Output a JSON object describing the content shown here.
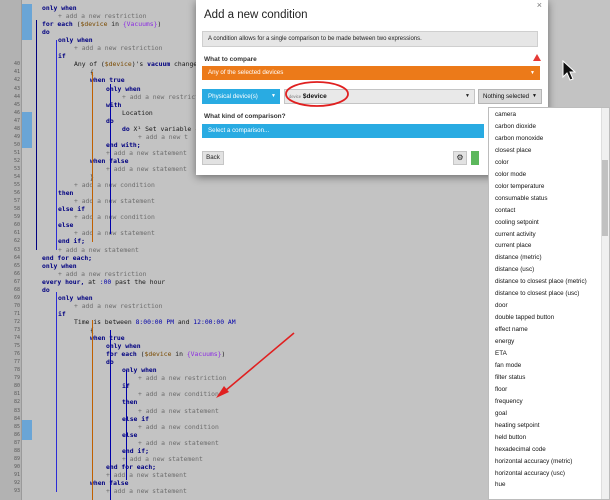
{
  "editor": {
    "lines": [
      {
        "n": "",
        "indent": 0,
        "parts": [
          {
            "c": "kw",
            "t": "only when"
          }
        ]
      },
      {
        "n": "",
        "indent": 1,
        "parts": [
          {
            "c": "add",
            "t": "+ add a new restriction"
          }
        ]
      },
      {
        "n": "",
        "indent": 0,
        "parts": [
          {
            "c": "kw",
            "t": "for each "
          },
          {
            "c": "",
            "t": "("
          },
          {
            "c": "var",
            "t": "$device"
          },
          {
            "c": "",
            "t": " in "
          },
          {
            "c": "var2",
            "t": "{Vacuums}"
          },
          {
            "c": "",
            "t": ")"
          }
        ]
      },
      {
        "n": "",
        "indent": 0,
        "parts": [
          {
            "c": "kw",
            "t": "do"
          }
        ]
      },
      {
        "n": "",
        "indent": 1,
        "parts": [
          {
            "c": "kw",
            "t": "only when"
          }
        ]
      },
      {
        "n": "",
        "indent": 2,
        "parts": [
          {
            "c": "add",
            "t": "+ add a new restriction"
          }
        ]
      },
      {
        "n": "",
        "indent": 1,
        "parts": [
          {
            "c": "kw",
            "t": "if"
          }
        ]
      },
      {
        "n": "",
        "indent": 2,
        "parts": [
          {
            "c": "",
            "t": "Any of ("
          },
          {
            "c": "var",
            "t": "$device"
          },
          {
            "c": "",
            "t": ")'s "
          },
          {
            "c": "kw",
            "t": "vacuum"
          },
          {
            "c": "",
            "t": " changes to 'c"
          }
        ]
      },
      {
        "n": "",
        "indent": 3,
        "parts": [
          {
            "c": "",
            "t": "{"
          }
        ]
      },
      {
        "n": "",
        "indent": 3,
        "parts": [
          {
            "c": "kw",
            "t": "when true"
          }
        ]
      },
      {
        "n": "",
        "indent": 4,
        "parts": [
          {
            "c": "kw",
            "t": "only when"
          }
        ]
      },
      {
        "n": "",
        "indent": 5,
        "parts": [
          {
            "c": "add",
            "t": "+ add a new restrict"
          }
        ]
      },
      {
        "n": "",
        "indent": 4,
        "parts": [
          {
            "c": "kw",
            "t": "with"
          }
        ]
      },
      {
        "n": "",
        "indent": 5,
        "parts": [
          {
            "c": "",
            "t": "Location"
          }
        ]
      },
      {
        "n": "",
        "indent": 4,
        "parts": [
          {
            "c": "kw",
            "t": "do"
          }
        ]
      },
      {
        "n": "",
        "indent": 5,
        "parts": [
          {
            "c": "kw",
            "t": "do "
          },
          {
            "c": "",
            "t": "X¹ Set variable "
          },
          {
            "c": "var",
            "t": "{$i"
          }
        ]
      },
      {
        "n": "",
        "indent": 6,
        "parts": [
          {
            "c": "add",
            "t": "+ add a new t"
          }
        ]
      },
      {
        "n": "",
        "indent": 4,
        "parts": [
          {
            "c": "kw",
            "t": "end with;"
          }
        ]
      },
      {
        "n": "",
        "indent": 4,
        "parts": [
          {
            "c": "add",
            "t": "+ add a new statement"
          }
        ]
      },
      {
        "n": "",
        "indent": 3,
        "parts": [
          {
            "c": "kw",
            "t": "when false"
          }
        ]
      },
      {
        "n": "",
        "indent": 4,
        "parts": [
          {
            "c": "add",
            "t": "+ add a new statement"
          }
        ]
      },
      {
        "n": "",
        "indent": 3,
        "parts": [
          {
            "c": "",
            "t": "}"
          }
        ]
      },
      {
        "n": "",
        "indent": 2,
        "parts": [
          {
            "c": "add",
            "t": "+ add a new condition"
          }
        ]
      },
      {
        "n": "",
        "indent": 1,
        "parts": [
          {
            "c": "kw",
            "t": "then"
          }
        ]
      },
      {
        "n": "",
        "indent": 2,
        "parts": [
          {
            "c": "add",
            "t": "+ add a new statement"
          }
        ]
      },
      {
        "n": "",
        "indent": 1,
        "parts": [
          {
            "c": "kw",
            "t": "else if"
          }
        ]
      },
      {
        "n": "",
        "indent": 2,
        "parts": [
          {
            "c": "add",
            "t": "+ add a new condition"
          }
        ]
      },
      {
        "n": "",
        "indent": 1,
        "parts": [
          {
            "c": "kw",
            "t": "else"
          }
        ]
      },
      {
        "n": "",
        "indent": 2,
        "parts": [
          {
            "c": "add",
            "t": "+ add a new statement"
          }
        ]
      },
      {
        "n": "",
        "indent": 1,
        "parts": [
          {
            "c": "kw",
            "t": "end if;"
          }
        ]
      },
      {
        "n": "",
        "indent": 1,
        "parts": [
          {
            "c": "add",
            "t": "+ add a new statement"
          }
        ]
      },
      {
        "n": "",
        "indent": 0,
        "parts": [
          {
            "c": "kw",
            "t": "end for each;"
          }
        ]
      },
      {
        "n": "",
        "indent": 0,
        "parts": [
          {
            "c": "kw",
            "t": "only when"
          }
        ]
      },
      {
        "n": "",
        "indent": 1,
        "parts": [
          {
            "c": "add",
            "t": "+ add a new restriction"
          }
        ]
      },
      {
        "n": "",
        "indent": 0,
        "parts": [
          {
            "c": "kw",
            "t": "every hour, "
          },
          {
            "c": "",
            "t": "at "
          },
          {
            "c": "tm",
            "t": ":00"
          },
          {
            "c": "",
            "t": " past the hour"
          }
        ]
      },
      {
        "n": "",
        "indent": 0,
        "parts": [
          {
            "c": "kw",
            "t": "do"
          }
        ]
      },
      {
        "n": "",
        "indent": 1,
        "parts": [
          {
            "c": "kw",
            "t": "only when"
          }
        ]
      },
      {
        "n": "",
        "indent": 2,
        "parts": [
          {
            "c": "add",
            "t": "+ add a new restriction"
          }
        ]
      },
      {
        "n": "",
        "indent": 1,
        "parts": [
          {
            "c": "kw",
            "t": "if"
          }
        ]
      },
      {
        "n": "",
        "indent": 2,
        "parts": [
          {
            "c": "",
            "t": "Time is between "
          },
          {
            "c": "tm",
            "t": "8:00:00 PM"
          },
          {
            "c": "",
            "t": " and "
          },
          {
            "c": "tm",
            "t": "12:00:00 AM"
          }
        ]
      },
      {
        "n": "",
        "indent": 3,
        "parts": [
          {
            "c": "",
            "t": "{"
          }
        ]
      },
      {
        "n": "",
        "indent": 3,
        "parts": [
          {
            "c": "kw",
            "t": "when true"
          }
        ]
      },
      {
        "n": "",
        "indent": 4,
        "parts": [
          {
            "c": "kw",
            "t": "only when"
          }
        ]
      },
      {
        "n": "",
        "indent": 4,
        "parts": [
          {
            "c": "kw",
            "t": "for each "
          },
          {
            "c": "",
            "t": "("
          },
          {
            "c": "var",
            "t": "$device"
          },
          {
            "c": "",
            "t": " in "
          },
          {
            "c": "var2",
            "t": "{Vacuums}"
          },
          {
            "c": "",
            "t": ")"
          }
        ]
      },
      {
        "n": "",
        "indent": 4,
        "parts": [
          {
            "c": "kw",
            "t": "do"
          }
        ]
      },
      {
        "n": "",
        "indent": 5,
        "parts": [
          {
            "c": "kw",
            "t": "only when"
          }
        ]
      },
      {
        "n": "",
        "indent": 6,
        "parts": [
          {
            "c": "add",
            "t": "+ add a new restriction"
          }
        ]
      },
      {
        "n": "",
        "indent": 5,
        "parts": [
          {
            "c": "kw",
            "t": "if"
          }
        ]
      },
      {
        "n": "",
        "indent": 6,
        "parts": [
          {
            "c": "add",
            "t": "+ add a new condition"
          }
        ]
      },
      {
        "n": "",
        "indent": 5,
        "parts": [
          {
            "c": "kw",
            "t": "then"
          }
        ]
      },
      {
        "n": "",
        "indent": 6,
        "parts": [
          {
            "c": "add",
            "t": "+ add a new statement"
          }
        ]
      },
      {
        "n": "",
        "indent": 5,
        "parts": [
          {
            "c": "kw",
            "t": "else if"
          }
        ]
      },
      {
        "n": "",
        "indent": 6,
        "parts": [
          {
            "c": "add",
            "t": "+ add a new condition"
          }
        ]
      },
      {
        "n": "",
        "indent": 5,
        "parts": [
          {
            "c": "kw",
            "t": "else"
          }
        ]
      },
      {
        "n": "",
        "indent": 6,
        "parts": [
          {
            "c": "add",
            "t": "+ add a new statement"
          }
        ]
      },
      {
        "n": "",
        "indent": 5,
        "parts": [
          {
            "c": "kw",
            "t": "end if;"
          }
        ]
      },
      {
        "n": "",
        "indent": 5,
        "parts": [
          {
            "c": "add",
            "t": "+ add a new statement"
          }
        ]
      },
      {
        "n": "",
        "indent": 4,
        "parts": [
          {
            "c": "kw",
            "t": "end for each;"
          }
        ]
      },
      {
        "n": "",
        "indent": 4,
        "parts": [
          {
            "c": "add",
            "t": "+ add a new statement"
          }
        ]
      },
      {
        "n": "",
        "indent": 3,
        "parts": [
          {
            "c": "kw",
            "t": "when false"
          }
        ]
      },
      {
        "n": "",
        "indent": 4,
        "parts": [
          {
            "c": "add",
            "t": "+ add a new statement"
          }
        ]
      }
    ],
    "line_numbers": [
      "",
      "",
      "",
      "",
      "",
      "",
      "",
      "40",
      "41",
      "42",
      "43",
      "44",
      "45",
      "46",
      "47",
      "48",
      "49",
      "50",
      "51",
      "52",
      "53",
      "54",
      "55",
      "56",
      "57",
      "58",
      "59",
      "60",
      "61",
      "62",
      "63",
      "64",
      "65",
      "66",
      "67",
      "68",
      "69",
      "70",
      "71",
      "72",
      "73",
      "74",
      "75",
      "76",
      "77",
      "78",
      "79",
      "80",
      "81",
      "82",
      "83",
      "84",
      "85",
      "86",
      "87",
      "88",
      "89",
      "90",
      "91",
      "92",
      "93",
      "94"
    ]
  },
  "dialog": {
    "title": "Add a new condition",
    "close": "×",
    "description": "A condition allows for a single comparison to be made between two expressions.",
    "compare_label": "What to compare",
    "compare_select": "Any of the selected devices",
    "device_type": "Physical device(s)",
    "device_prefix": "device",
    "device_value": "$device",
    "attribute_select": "Nothing selected",
    "comparison_label": "What kind of comparison?",
    "comparison_select": "Select a comparison...",
    "back_label": "Back",
    "gear_glyph": "⚙"
  },
  "dropdown": {
    "items": [
      "camera",
      "carbon dioxide",
      "carbon monoxide",
      "closest place",
      "color",
      "color mode",
      "color temperature",
      "consumable status",
      "contact",
      "cooling setpoint",
      "current activity",
      "current place",
      "distance (metric)",
      "distance (usc)",
      "distance to closest place (metric)",
      "distance to closest place (usc)",
      "door",
      "double tapped button",
      "effect name",
      "energy",
      "ETA",
      "fan mode",
      "filter status",
      "floor",
      "frequency",
      "goal",
      "heating setpoint",
      "held button",
      "hexadecimal code",
      "horizontal accuracy (metric)",
      "horizontal accuracy (usc)",
      "hue"
    ]
  },
  "colors": {
    "orange": "#ec7a19",
    "blue": "#29abe2",
    "red_annotation": "#e02020"
  }
}
